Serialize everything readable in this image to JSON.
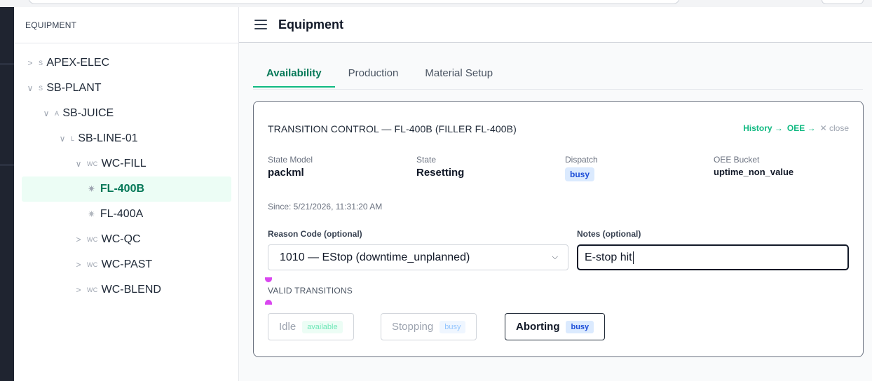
{
  "sidebar": {
    "header": "EQUIPMENT",
    "tree": [
      {
        "chevron": ">",
        "type": "S",
        "label": "APEX-ELEC"
      },
      {
        "chevron": "∨",
        "type": "S",
        "label": "SB-PLANT"
      },
      {
        "chevron": "∨",
        "type": "A",
        "label": "SB-JUICE"
      },
      {
        "chevron": "∨",
        "type": "L",
        "label": "SB-LINE-01"
      },
      {
        "chevron": "∨",
        "type": "WC",
        "label": "WC-FILL"
      },
      {
        "label": "FL-400B",
        "icon": "gear-icon",
        "selected": true
      },
      {
        "label": "FL-400A",
        "icon": "gear-icon"
      },
      {
        "chevron": ">",
        "type": "WC",
        "label": "WC-QC"
      },
      {
        "chevron": ">",
        "type": "WC",
        "label": "WC-PAST"
      },
      {
        "chevron": ">",
        "type": "WC",
        "label": "WC-BLEND"
      }
    ]
  },
  "header": {
    "title": "Equipment"
  },
  "tabs": [
    "Availability",
    "Production",
    "Material Setup"
  ],
  "card": {
    "title": "TRANSITION CONTROL — FL-400B (FILLER FL-400B)",
    "links": {
      "history": "History →",
      "oee": "OEE →",
      "close": "✕ close"
    },
    "fields": {
      "state_model": {
        "label": "State Model",
        "value": "packml"
      },
      "state": {
        "label": "State",
        "value": "Resetting"
      },
      "dispatch": {
        "label": "Dispatch",
        "value": "busy"
      },
      "oee_bucket": {
        "label": "OEE Bucket",
        "value": "uptime_non_value"
      }
    },
    "since": "Since: 5/21/2026, 11:31:20 AM",
    "reason_code": {
      "label": "Reason Code (optional)",
      "value": "1010 — EStop (downtime_unplanned)"
    },
    "notes": {
      "label": "Notes (optional)",
      "value": "E-stop hit"
    },
    "valid_transitions_label": "VALID TRANSITIONS",
    "transitions": [
      {
        "label": "Idle",
        "badge": "available",
        "enabled": false
      },
      {
        "label": "Stopping",
        "badge": "busy",
        "enabled": false
      },
      {
        "label": "Aborting",
        "badge": "busy",
        "enabled": true
      }
    ]
  },
  "colors": {
    "accent": "#10b981",
    "accent_text": "#047857",
    "busy_bg": "#dbeafe",
    "busy_text": "#1d4ed8",
    "marker": "#d946ef"
  }
}
